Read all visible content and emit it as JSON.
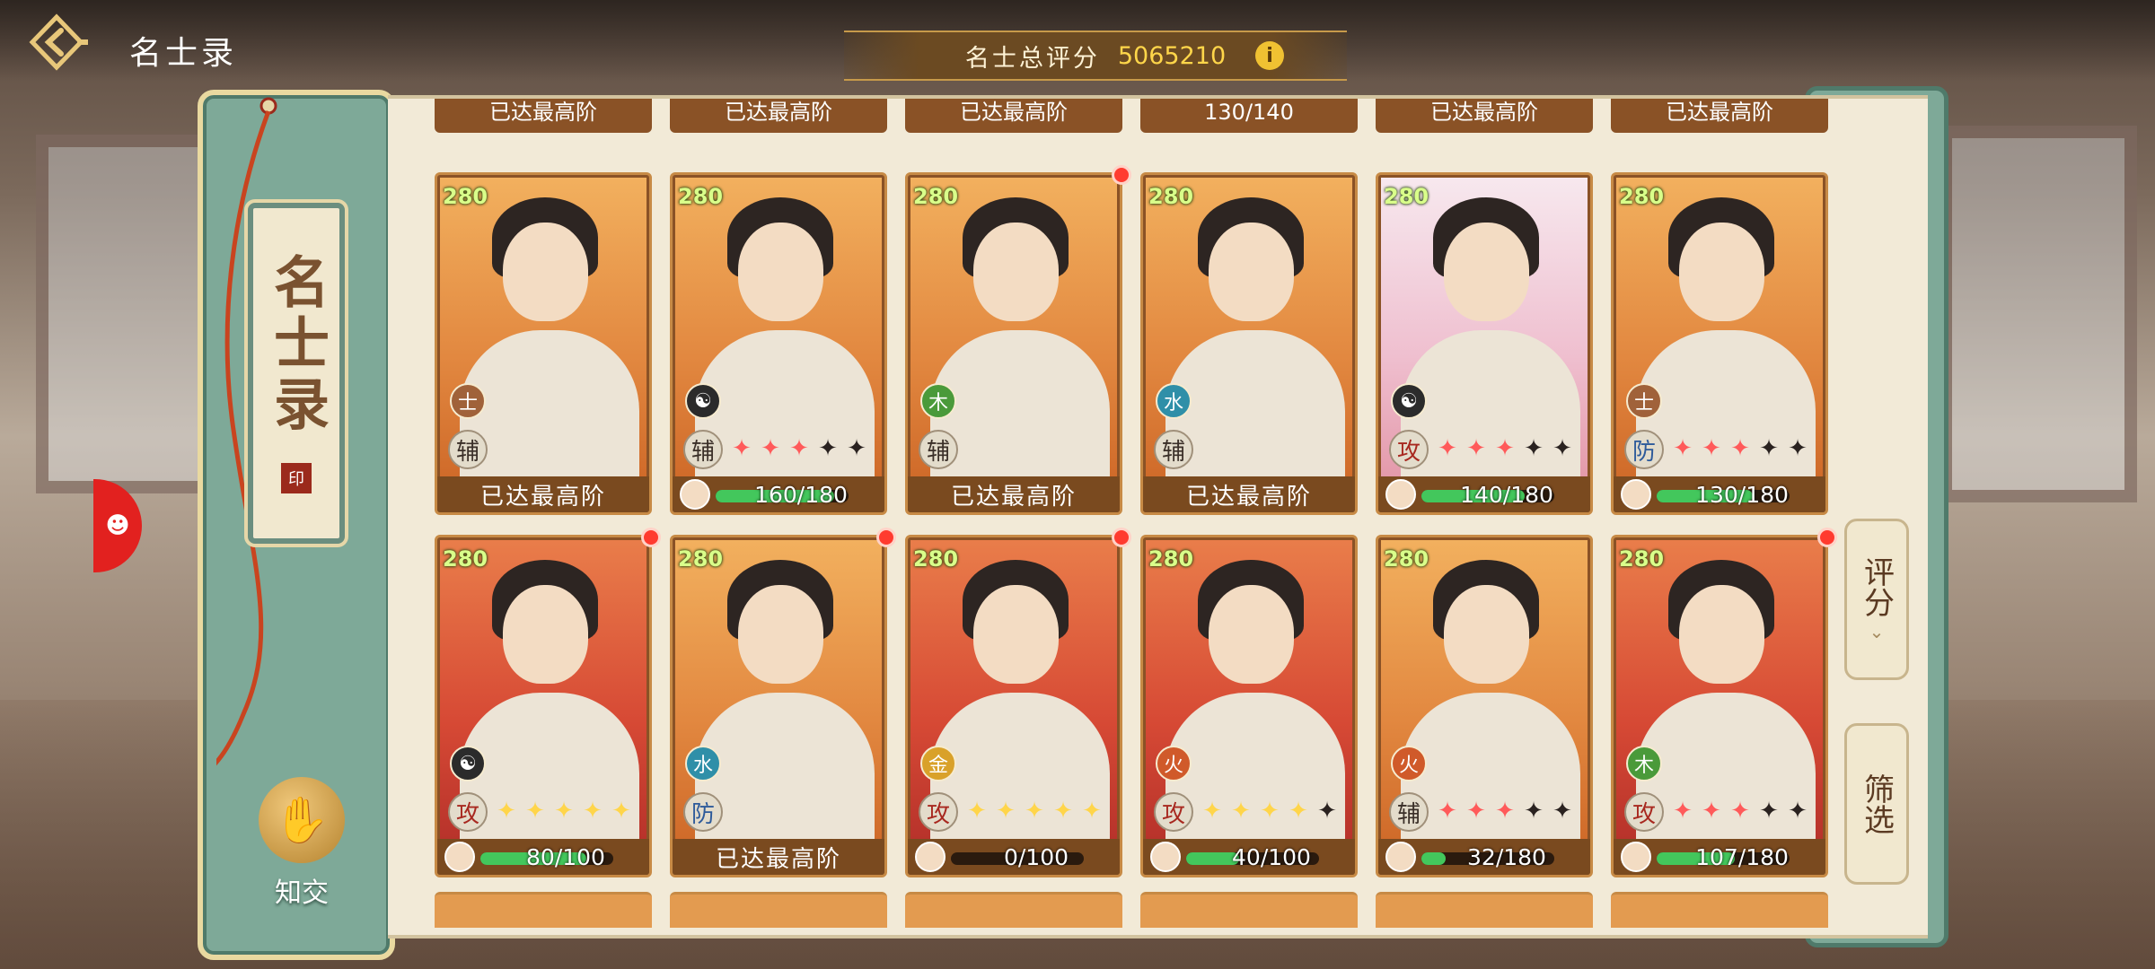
{
  "header": {
    "title": "名士录",
    "score_label": "名士总评分",
    "score_value": "5065210",
    "info_icon": "info-icon"
  },
  "left_panel": {
    "scroll_title": "名士录",
    "zhijiao_label": "知交"
  },
  "side_buttons": {
    "sort_label": "评分",
    "filter_label": "筛选"
  },
  "top_partial_row": [
    "已达最高阶",
    "已达最高阶",
    "已达最高阶",
    "130/140",
    "已达最高阶",
    "已达最高阶"
  ],
  "cards": [
    {
      "level": "280",
      "faction": "士",
      "faction_color": "#a0623a",
      "role": "辅",
      "stars": null,
      "footer": "已达最高阶",
      "progress": null,
      "theme": "orange",
      "dot": false
    },
    {
      "level": "280",
      "faction": "☯",
      "faction_color": "#2b2b2b",
      "role": "辅",
      "stars": [
        1,
        1,
        1,
        0,
        0
      ],
      "footer": "160/180",
      "progress": 0.89,
      "theme": "orange",
      "dot": false
    },
    {
      "level": "280",
      "faction": "木",
      "faction_color": "#4a9a3a",
      "role": "辅",
      "stars": null,
      "footer": "已达最高阶",
      "progress": null,
      "theme": "orange",
      "dot": true
    },
    {
      "level": "280",
      "faction": "水",
      "faction_color": "#2f8fa8",
      "role": "辅",
      "stars": null,
      "footer": "已达最高阶",
      "progress": null,
      "theme": "orange",
      "dot": false
    },
    {
      "level": "280",
      "faction": "☯",
      "faction_color": "#2b2b2b",
      "role": "攻",
      "stars": [
        1,
        1,
        1,
        0,
        0
      ],
      "footer": "140/180",
      "progress": 0.78,
      "theme": "pink",
      "dot": false
    },
    {
      "level": "280",
      "faction": "士",
      "faction_color": "#a0623a",
      "role": "防",
      "stars": [
        1,
        1,
        1,
        0,
        0
      ],
      "footer": "130/180",
      "progress": 0.72,
      "theme": "orange",
      "dot": false
    },
    {
      "level": "280",
      "faction": "☯",
      "faction_color": "#2b2b2b",
      "role": "攻",
      "stars": [
        2,
        2,
        2,
        2,
        2
      ],
      "footer": "80/100",
      "progress": 0.8,
      "theme": "red",
      "dot": true
    },
    {
      "level": "280",
      "faction": "水",
      "faction_color": "#2f8fa8",
      "role": "防",
      "stars": null,
      "footer": "已达最高阶",
      "progress": null,
      "theme": "orange",
      "dot": true
    },
    {
      "level": "280",
      "faction": "金",
      "faction_color": "#d9a12a",
      "role": "攻",
      "stars": [
        2,
        2,
        2,
        2,
        2
      ],
      "footer": "0/100",
      "progress": 0.0,
      "theme": "red",
      "dot": true
    },
    {
      "level": "280",
      "faction": "火",
      "faction_color": "#d05a2a",
      "role": "攻",
      "stars": [
        2,
        2,
        2,
        2,
        0
      ],
      "footer": "40/100",
      "progress": 0.4,
      "theme": "red",
      "dot": false
    },
    {
      "level": "280",
      "faction": "火",
      "faction_color": "#d05a2a",
      "role": "辅",
      "stars": [
        1,
        1,
        1,
        0,
        0
      ],
      "footer": "32/180",
      "progress": 0.18,
      "theme": "orange",
      "dot": false
    },
    {
      "level": "280",
      "faction": "木",
      "faction_color": "#4a9a3a",
      "role": "攻",
      "stars": [
        1,
        1,
        1,
        0,
        0
      ],
      "footer": "107/180",
      "progress": 0.59,
      "theme": "red",
      "dot": true
    }
  ],
  "colors": {
    "panel_green": "#7ea998",
    "paper": "#f2ead7",
    "card_frame": "#8a5226",
    "score_gold": "#ffd64a",
    "level_green": "#d9ff8a"
  }
}
